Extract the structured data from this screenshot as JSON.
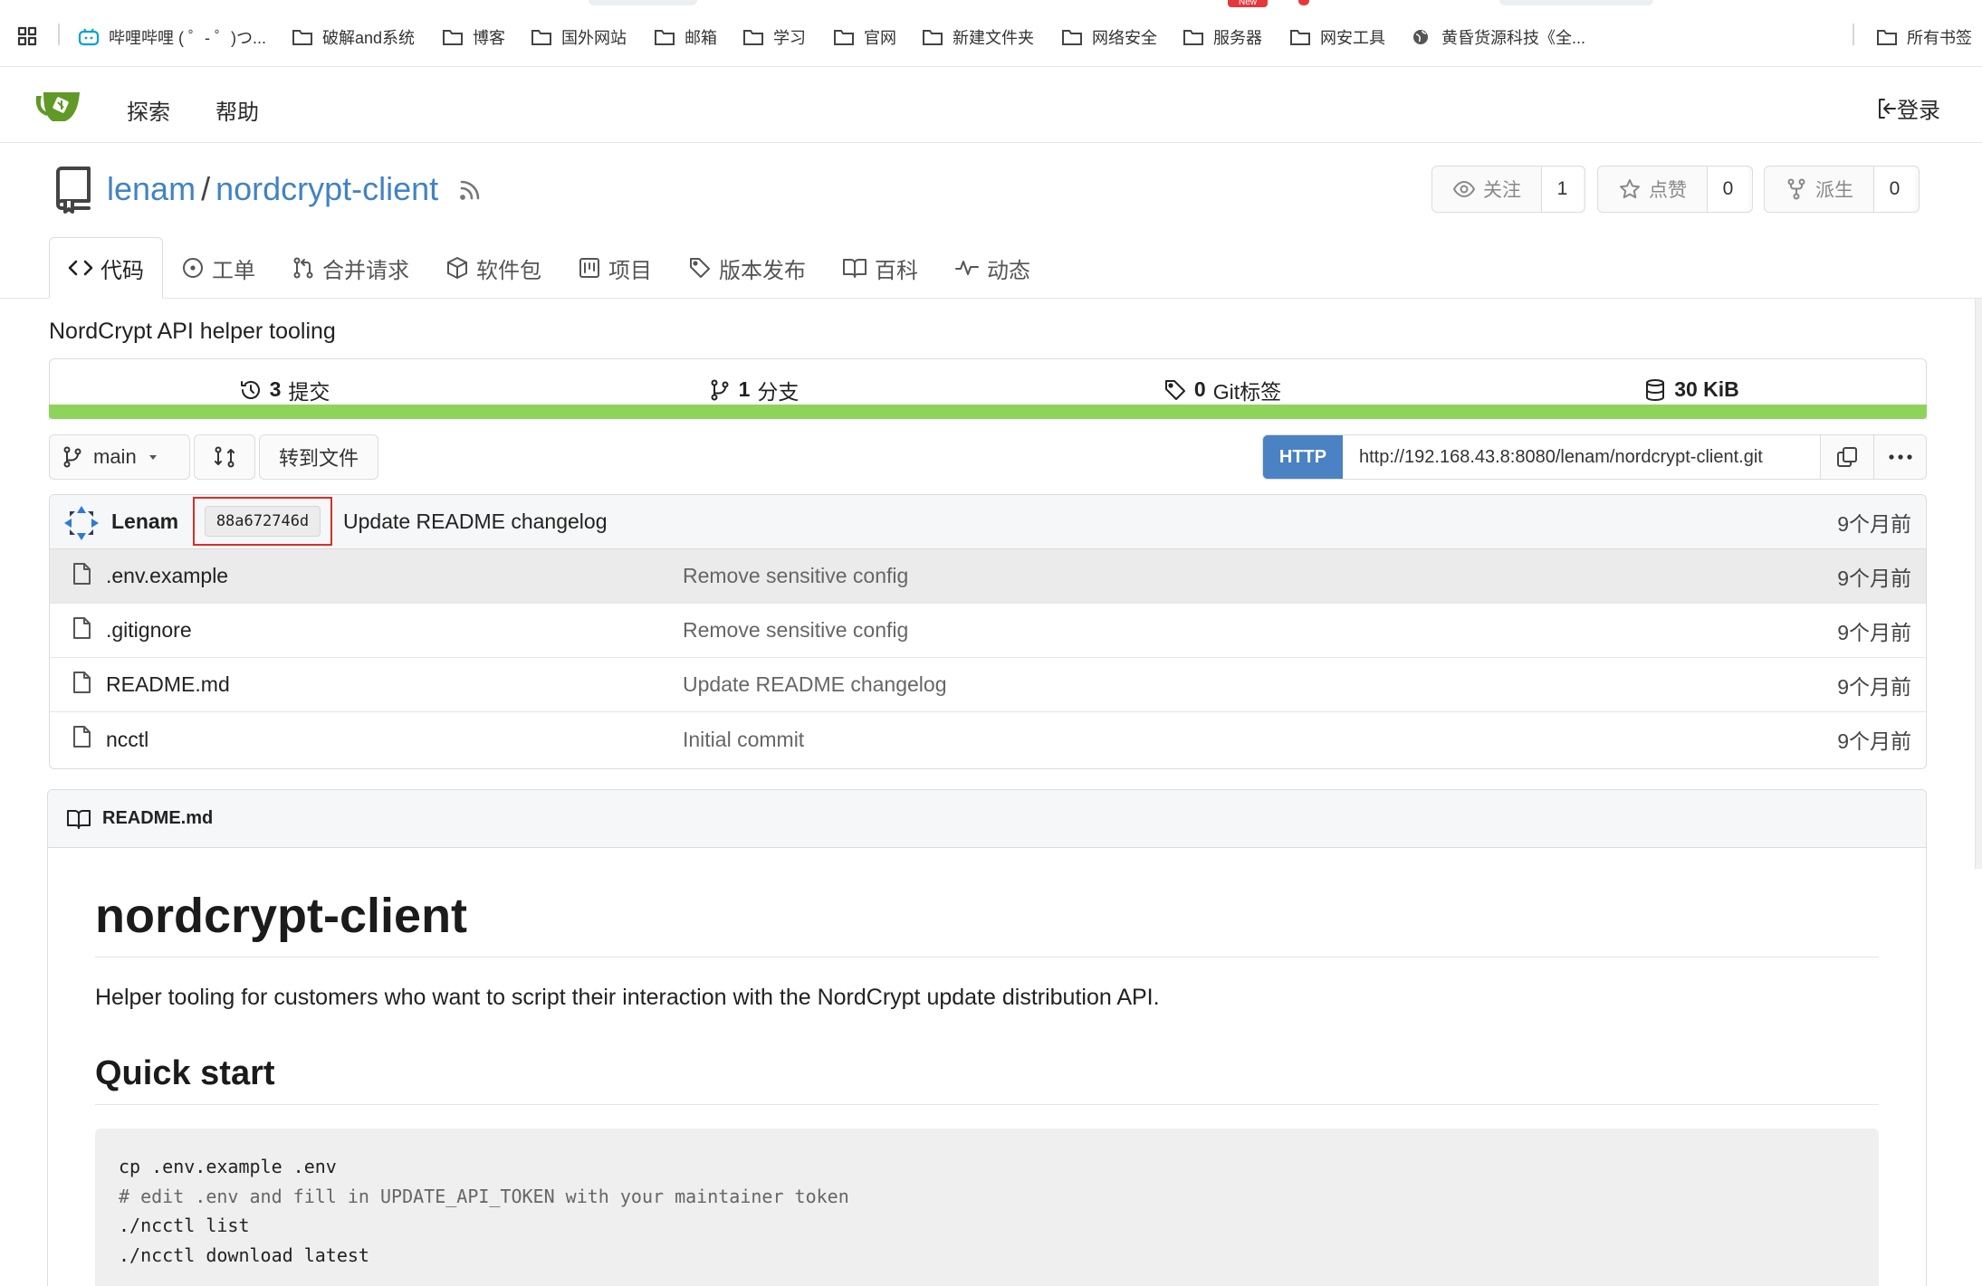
{
  "bookmarks": {
    "items": [
      {
        "label": "哔哩哔哩 ( ゜- ゜)つ..."
      },
      {
        "label": "破解and系统"
      },
      {
        "label": "博客"
      },
      {
        "label": "国外网站"
      },
      {
        "label": "邮箱"
      },
      {
        "label": "学习"
      },
      {
        "label": "官网"
      },
      {
        "label": "新建文件夹"
      },
      {
        "label": "网络安全"
      },
      {
        "label": "服务器"
      },
      {
        "label": "网安工具"
      },
      {
        "label": "黄昏货源科技《全..."
      }
    ],
    "all_bookmarks": "所有书签",
    "new_badge": "New"
  },
  "navbar": {
    "explore": "探索",
    "help": "帮助",
    "login": "登录"
  },
  "repo": {
    "owner": "lenam",
    "slash": "/",
    "name": "nordcrypt-client",
    "watch_label": "关注",
    "watch_count": "1",
    "star_label": "点赞",
    "star_count": "0",
    "fork_label": "派生",
    "fork_count": "0",
    "description": "NordCrypt API helper tooling"
  },
  "tabs": [
    {
      "label": "代码",
      "icon": "code-icon"
    },
    {
      "label": "工单",
      "icon": "issue-icon"
    },
    {
      "label": "合并请求",
      "icon": "pull-request-icon"
    },
    {
      "label": "软件包",
      "icon": "package-icon"
    },
    {
      "label": "项目",
      "icon": "project-icon"
    },
    {
      "label": "版本发布",
      "icon": "tag-icon"
    },
    {
      "label": "百科",
      "icon": "book-icon"
    },
    {
      "label": "动态",
      "icon": "pulse-icon"
    }
  ],
  "stats": {
    "commits_num": "3",
    "commits_label": "提交",
    "branches_num": "1",
    "branches_label": "分支",
    "tags_num": "0",
    "tags_label": "Git标签",
    "size": "30 KiB",
    "language_color": "#8ed45a"
  },
  "toolbar": {
    "branch": "main",
    "goto_file": "转到文件",
    "protocol": "HTTP",
    "clone_url": "http://192.168.43.8:8080/lenam/nordcrypt-client.git"
  },
  "latest_commit": {
    "author": "Lenam",
    "sha": "88a672746d",
    "message": "Update README changelog",
    "time": "9个月前"
  },
  "files": [
    {
      "name": ".env.example",
      "message": "Remove sensitive config",
      "time": "9个月前"
    },
    {
      "name": ".gitignore",
      "message": "Remove sensitive config",
      "time": "9个月前"
    },
    {
      "name": "README.md",
      "message": "Update README changelog",
      "time": "9个月前"
    },
    {
      "name": "ncctl",
      "message": "Initial commit",
      "time": "9个月前"
    }
  ],
  "readme": {
    "filename": "README.md",
    "h1": "nordcrypt-client",
    "intro": "Helper tooling for customers who want to script their interaction with the NordCrypt update distribution API.",
    "h2": "Quick start",
    "code": [
      "cp .env.example .env",
      "# edit .env and fill in UPDATE_API_TOKEN with your maintainer token",
      "./ncctl list",
      "./ncctl download latest"
    ]
  },
  "colors": {
    "link": "#4183c4",
    "http_button": "#4a82c3",
    "highlight_border": "#d93025"
  }
}
